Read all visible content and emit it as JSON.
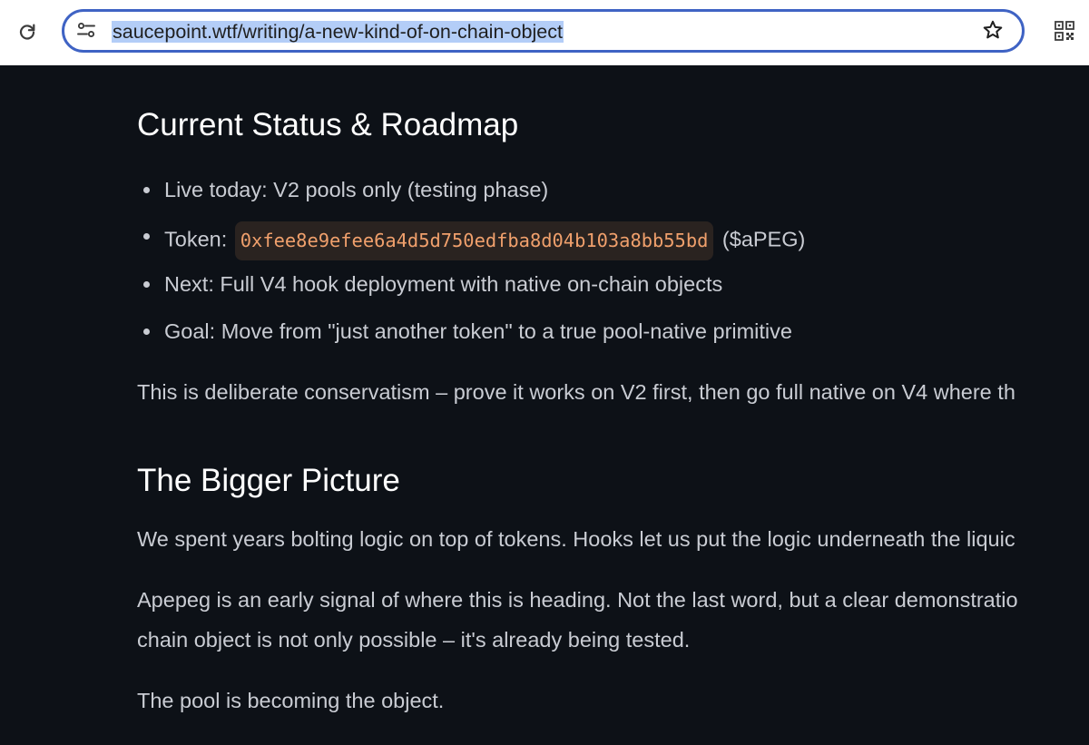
{
  "browser": {
    "reload_icon": "reload-icon",
    "site_info_icon": "tune-icon",
    "url": "saucepoint.wtf/writing/a-new-kind-of-on-chain-object",
    "bookmark_icon": "star-icon",
    "qr_icon": "qr-code-icon"
  },
  "article": {
    "roadmap_heading": "Current Status & Roadmap",
    "list": [
      {
        "text": "Live today: V2 pools only (testing phase)"
      },
      {
        "prefix": "Token: ",
        "code": "0xfee8e9efee6a4d5d750edfba8d04b103a8bb55bd",
        "suffix": " ($aPEG)"
      },
      {
        "text": "Next: Full V4 hook deployment with native on-chain objects"
      },
      {
        "text": "Goal: Move from \"just another token\" to a true pool-native primitive"
      }
    ],
    "conservatism_paragraph": "This is deliberate conservatism – prove it works on V2 first, then go full native on V4 where th",
    "bigger_heading": "The Bigger Picture",
    "paragraph_1": "We spent years bolting logic on top of tokens. Hooks let us put the logic underneath the liquic",
    "paragraph_2_line_1": "Apepeg is an early signal of where this is heading. Not the last word, but a clear demonstratio",
    "paragraph_2_line_2": "chain object is not only possible – it's already being tested.",
    "paragraph_3": "The pool is becoming the object."
  },
  "colors": {
    "page_background": "#0d1117",
    "heading_text": "#ffffff",
    "body_text": "#c9ccd3",
    "code_text": "#f0a06c",
    "code_background": "#2a2320",
    "omnibox_focus_ring": "#3f63c4",
    "url_selection": "#b3cdf7"
  }
}
